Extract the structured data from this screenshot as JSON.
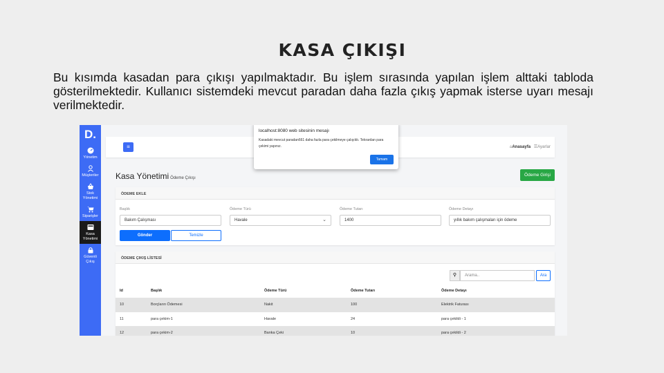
{
  "slide": {
    "title": "KASA ÇIKIŞI",
    "description": "Bu kısımda kasadan para çıkışı yapılmaktadır. Bu işlem sırasında yapılan işlem alttaki tabloda gösterilmektedir. Kullanıcı sistemdeki mevcut paradan daha fazla çıkış yapmak isterse uyarı mesajı verilmektedir."
  },
  "sidebar": {
    "logo": "D.",
    "items": [
      {
        "label": "Yönetim",
        "icon": "dashboard-icon"
      },
      {
        "label": "Müşteriler",
        "icon": "user-icon"
      },
      {
        "label": "Stok Yönetimi",
        "icon": "basket-icon"
      },
      {
        "label": "Siparişler",
        "icon": "cart-icon"
      },
      {
        "label": "Kasa Yönetimi",
        "icon": "cash-register-icon",
        "active": true
      },
      {
        "label": "Güvenli Çıkış",
        "icon": "lock-icon"
      }
    ]
  },
  "topbar": {
    "home_label": "Anasayfa",
    "settings_label": "Ayarlar"
  },
  "page": {
    "title": "Kasa Yönetimi",
    "subtitle": "Ödeme Çıkışı",
    "entry_button": "Ödeme Girişi"
  },
  "form": {
    "header": "ÖDEME EKLE",
    "fields": {
      "title_label": "Başlık",
      "title_value": "Bakım Çalışması",
      "type_label": "Ödeme Türü",
      "type_value": "Havale",
      "amount_label": "Ödeme Tutarı",
      "amount_value": "1400",
      "detail_label": "Ödeme Detayı",
      "detail_value": "yıllık bakım çalışmaları için ödeme"
    },
    "submit_label": "Gönder",
    "clear_label": "Temizle"
  },
  "list": {
    "header": "ÖDEME ÇIKIŞ LİSTESİ",
    "search_placeholder": "Arama..",
    "search_button": "Ara",
    "columns": [
      "Id",
      "Başlık",
      "Ödeme Türü",
      "Ödeme Tutarı",
      "Ödeme Detayı"
    ],
    "rows": [
      [
        "10",
        "Borçların Ödemesi",
        "Nakit",
        "100",
        "Elektrik Faturası"
      ],
      [
        "11",
        "para çekim-1",
        "Havale",
        "24",
        "para çekildi - 1"
      ],
      [
        "12",
        "para çekim-2",
        "Banka Çeki",
        "10",
        "para çekildi - 2"
      ]
    ]
  },
  "dialog": {
    "title": "localhost:8080 web sitesinin mesajı",
    "message": "Kasadaki mevcut paradan661 daha fazla para çekilmeye çalışıldı. Tekrardan para çekimi yapınız.",
    "ok_label": "Tamam"
  },
  "colors": {
    "sidebar": "#3d6bf5",
    "primary": "#0d6efd",
    "success": "#28a745",
    "active_nav": "#1a1a1a"
  }
}
